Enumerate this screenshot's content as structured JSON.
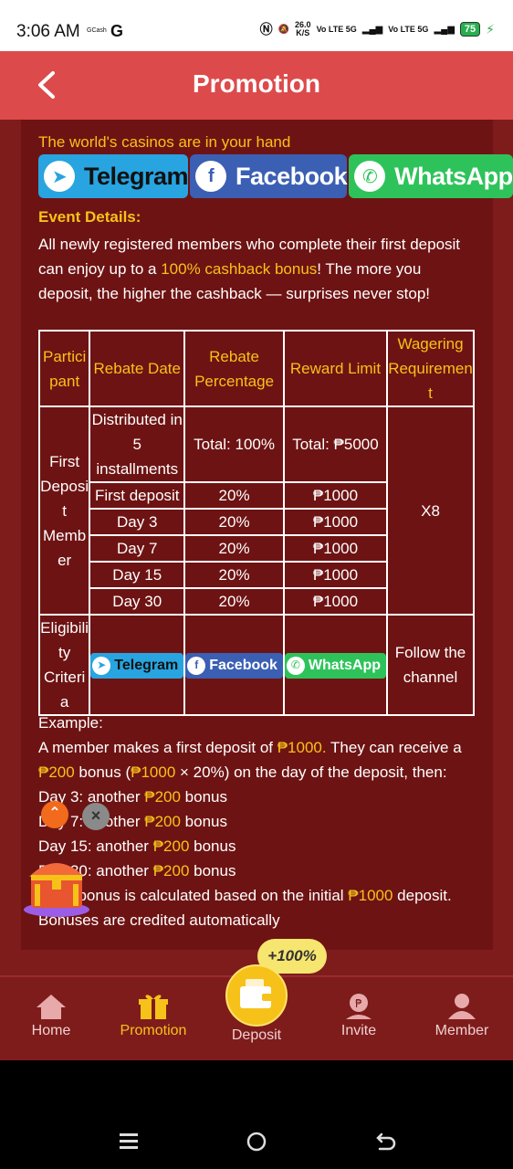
{
  "status_bar": {
    "time": "3:06 AM",
    "gcash": "GCash",
    "g": "G",
    "speed_value": "26.0",
    "speed_unit": "K/S",
    "net1": "Vo LTE",
    "net1_gen": "5G",
    "net2": "Vo LTE",
    "net2_gen": "5G",
    "battery": "75"
  },
  "header": {
    "title": "Promotion"
  },
  "promo": {
    "tagline": "The world's casinos are in your hand",
    "social": {
      "telegram": "Telegram",
      "facebook": "Facebook",
      "whatsapp": "WhatsApp"
    },
    "event_title": "Event Details:",
    "desc_part1": "All newly registered members who complete their first deposit can enjoy up to a ",
    "desc_highlight": "100% cashback bonus",
    "desc_part2": "! The more you deposit, the higher the cashback — surprises never stop!"
  },
  "table": {
    "headers": [
      "Partici pant",
      "Rebate Date",
      "Rebate Percentage",
      "Reward Limit",
      "Wagering Requiremen t"
    ],
    "participant": "First Deposi t Memb er",
    "wagering": "X8",
    "rows": [
      {
        "date": "Distributed in 5 installments",
        "pct": "Total: 100%",
        "limit": "Total: ₱5000"
      },
      {
        "date": "First deposit",
        "pct": "20%",
        "limit": "₱1000"
      },
      {
        "date": "Day 3",
        "pct": "20%",
        "limit": "₱1000"
      },
      {
        "date": "Day 7",
        "pct": "20%",
        "limit": "₱1000"
      },
      {
        "date": "Day 15",
        "pct": "20%",
        "limit": "₱1000"
      },
      {
        "date": "Day 30",
        "pct": "20%",
        "limit": "₱1000"
      }
    ],
    "eligibility_label": "Eligibili ty Criteri a",
    "eligibility_tg": "Telegram",
    "eligibility_fb": "Facebook",
    "eligibility_wa": "WhatsApp",
    "eligibility_action": "Follow the channel"
  },
  "example": {
    "title": "Example:",
    "l1a": "A member makes a first deposit of ",
    "l1b": "₱1000.",
    "l1c": " They can receive a ",
    "l1d": "₱200",
    "l1e": " bonus (",
    "l1f": "₱1000",
    "l1g": " × 20%) on the day of the deposit, then:",
    "d3a": "Day 3: another ",
    "d3b": "₱200",
    "d3c": " bonus",
    "d7a": "Day 7: another ",
    "d7b": "₱200",
    "d7c": " bonus",
    "d15a": "Day 15: another ",
    "d15b": "₱200",
    "d15c": " bonus",
    "d30a": "Day 30: another ",
    "d30b": "₱200",
    "d30c": " bonus",
    "tail1": "Each bonus is calculated based on the initial ",
    "tail2": "₱1000",
    "tail3": " deposit. Bonuses are credited automatically"
  },
  "float": {
    "bonus_tag": "+100%"
  },
  "nav": {
    "home": "Home",
    "promotion": "Promotion",
    "deposit": "Deposit",
    "invite": "Invite",
    "member": "Member"
  },
  "colors": {
    "header": "#dd4a4b",
    "page": "#7e1c1c",
    "accent": "#f6c21a"
  }
}
